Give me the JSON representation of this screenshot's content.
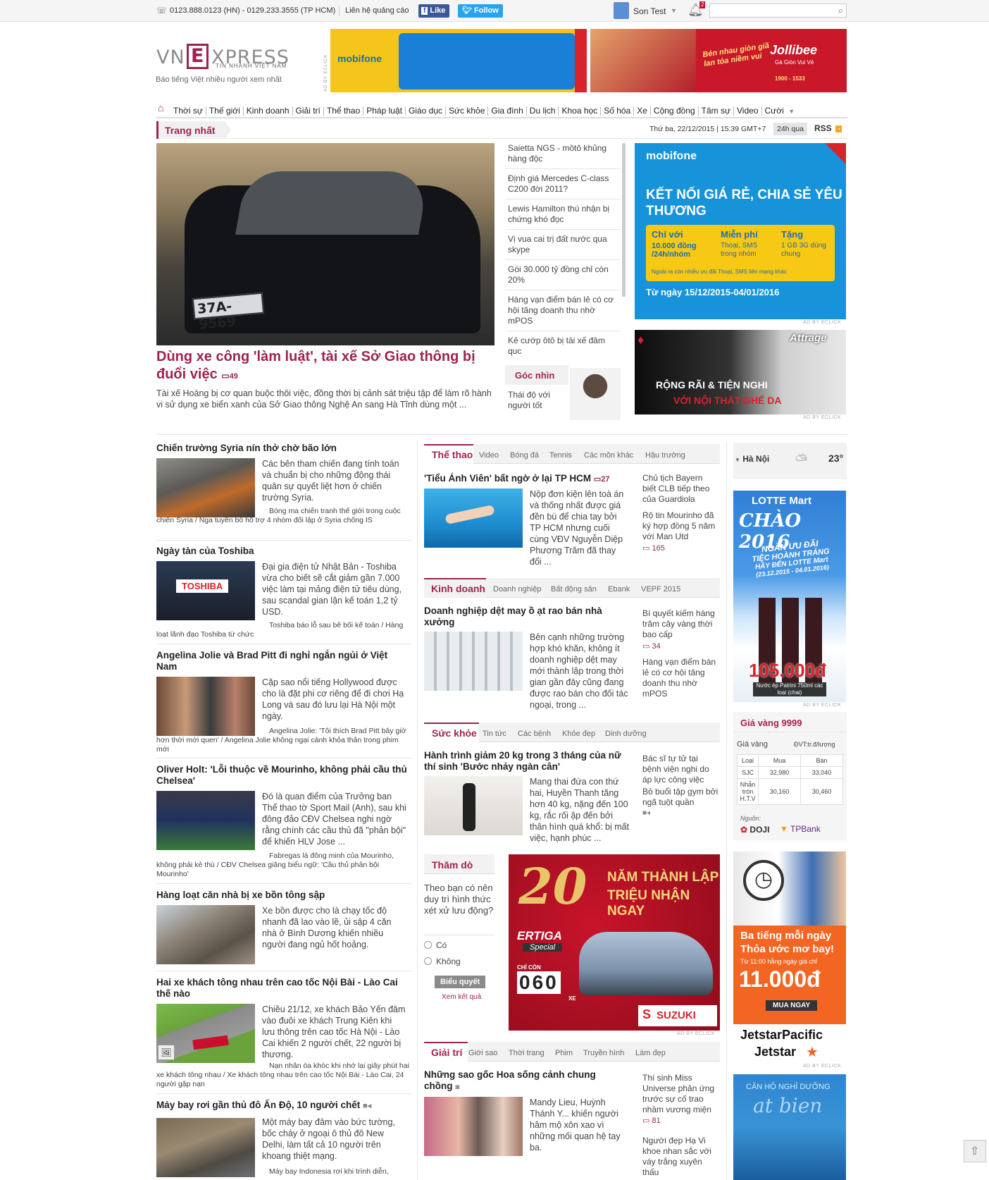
{
  "topbar": {
    "phone": "0123.888.0123 (HN) - 0129.233.3555 (TP HCM)",
    "ad_contact": "Liên hệ quảng cáo",
    "fb_like": "Like",
    "tw_follow": "Follow",
    "user_name": "Son Test",
    "notif_count": "2",
    "search_placeholder": ""
  },
  "logo": {
    "pre": "VN",
    "e": "E",
    "post": "XPRESS",
    "tagline_small": "TIN NHANH VIỆT NAM",
    "slogan": "Báo tiếng Việt nhiều người xem nhất"
  },
  "ads": {
    "ad_label": "AD BY ECLICK",
    "mobifone_top": "mobifone",
    "jollibee_slogan": "Bén nhau giòn giã lan tỏa niềm vui",
    "jollibee_brand": "Jollibee",
    "jollibee_sub": "Gà Giòn Vui Vẻ",
    "jollibee_phone": "1900 - 1533",
    "mobifone_big_brand": "mobifone",
    "mobifone_big_title": "KẾT NỐI GIÁ RẺ, CHIA SẺ YÊU THƯƠNG",
    "mobifone_col1_h": "Chỉ với",
    "mobifone_col1_t": "10.000 đồng /24h/nhóm",
    "mobifone_col2_h": "Miễn phí",
    "mobifone_col2_t": "Thoại, SMS trong nhóm",
    "mobifone_col3_h": "Tặng",
    "mobifone_col3_t": "1 GB 3G dùng chung",
    "mobifone_note": "Ngoài ra còn nhiều ưu đãi Thoại, SMS liên mạng khác",
    "mobifone_date": "Từ ngày 15/12/2015-04/01/2016",
    "mitsubishi_model": "Attrage",
    "mitsubishi_l1": "RỘNG RÃI & TIỆN NGHI",
    "mitsubishi_l2": "VỚI NỘI THẤT GHẾ DA",
    "lotte_brand": "LOTTE Mart",
    "lotte_chao": "CHÀO 2016",
    "lotte_l1": "NGÀN ƯU ĐÃI",
    "lotte_l2": "TIỆC HOÀNH TRÁNG",
    "lotte_l3": "HÃY ĐẾN LOTTE Mart",
    "lotte_date": "(23.12.2015 - 04.01.2016)",
    "lotte_price": "105.000đ",
    "lotte_item": "Nước ép Patrini 750ml các loại (chai)",
    "suzuki_20": "20",
    "suzuki_l1": "NĂM THÀNH LẬP",
    "suzuki_l2": "TRIỆU NHẬN NGAY",
    "suzuki_model": "ERTIGA",
    "suzuki_special": "Special",
    "suzuki_chicon": "CHỈ CÒN",
    "suzuki_num": "060",
    "suzuki_xe": "XE",
    "suzuki_brand": "SUZUKI",
    "jetstar_l1": "Ba tiếng mỗi ngày",
    "jetstar_l2": "Thỏa ước mơ bay!",
    "jetstar_l3": "Từ 11:00 hằng ngày giá chỉ",
    "jetstar_price": "11.000đ",
    "jetstar_buy": "MUA NGAY",
    "jetstar_brand1": "JetstarPacific",
    "jetstar_brand2": "Jetstar",
    "resort_l1": "CĂN HỘ NGHỈ DƯỠNG",
    "resort_l2": "at bien"
  },
  "nav": {
    "items": [
      "Thời sự",
      "Thế giới",
      "Kinh doanh",
      "Giải trí",
      "Thể thao",
      "Pháp luật",
      "Giáo dục",
      "Sức khỏe",
      "Gia đình",
      "Du lịch",
      "Khoa học",
      "Số hóa",
      "Xe",
      "Cộng đồng",
      "Tâm sự",
      "Video",
      "Cười"
    ]
  },
  "breadcrumb": {
    "label": "Trang nhất",
    "datetime": "Thứ ba, 22/12/2015 | 15:39 GMT+7",
    "btn_24h": "24h qua",
    "rss": "RSS"
  },
  "featured": {
    "plate": "37A-9569",
    "title": "Dùng xe công 'làm luật', tài xế Sở Giao thông bị đuổi việc",
    "comments": "49",
    "lead": "Tài xế Hoàng bị cơ quan buộc thôi việc, đồng thời bị cảnh sát triệu tập để làm rõ hành vi sử dụng xe biển xanh của Sở Giao thông Nghệ An sang Hà Tĩnh dùng một ..."
  },
  "side_news": [
    "Saietta NGS - môtô khủng hàng độc",
    "Định giá Mercedes C-class C200 đời 2011?",
    "Lewis Hamilton thú nhận bị chứng khó đọc",
    "Vị vua cai trị đất nước qua skype",
    "Gói 30.000 tỷ đồng chỉ còn 20%",
    "Hàng vạn điểm bán lẻ có cơ hội tăng doanh thu nhờ mPOS",
    "Kẻ cướp ôtô bị tài xế đâm quc"
  ],
  "gocnhin": {
    "label": "Góc nhìn",
    "text": "Thái độ với người tốt"
  },
  "left_news": [
    {
      "title": "Chiến trường Syria nín thở chờ bão lớn",
      "lead": "Các bên tham chiến đang tính toán và chuẩn bị cho những động thái quân sự quyết liệt hơn ở chiến trường Syria.",
      "sub": "Bóng ma chiến tranh thế giới trong cuộc chiến Syria / Nga tuyên bố hỗ trợ 4 nhóm đối lập ở Syria chống IS"
    },
    {
      "title": "Ngày tàn của Toshiba",
      "lead": "Đại gia điện tử Nhật Bản - Toshiba vừa cho biết sẽ cắt giảm gần 7.000 việc làm tại mảng điện tử tiêu dùng, sau scandal gian lận kế toán 1,2 tỷ USD.",
      "sub": "Toshiba báo lỗ sau bê bối kế toán / Hàng loạt lãnh đạo Toshiba từ chức",
      "sign": "TOSHIBA"
    },
    {
      "title": "Angelina Jolie và Brad Pitt đi nghỉ ngắn ngủi ở Việt Nam",
      "lead": "Cặp sao nổi tiếng Hollywood được cho là đặt phi cơ riêng để đi chơi Hạ Long và sau đó lưu lại Hà Nội một ngày.",
      "sub": "Angelina Jolie: 'Tôi thích Brad Pitt bây giờ hơn thời mới quen' / Angelina Jolie không ngại cảnh khỏa thân trong phim mới"
    },
    {
      "title": "Oliver Holt: 'Lỗi thuộc về Mourinho, không phải cầu thủ Chelsea'",
      "lead": "Đó là quan điểm của Trưởng ban Thể thao tờ Sport Mail (Anh), sau khi đông đảo CĐV Chelsea nghi ngờ rằng chính các cầu thủ đã \"phản bội\" để khiến HLV Jose ...",
      "sub": "Fabregas lá đông minh của Mourinho, không phải kẻ thù / CĐV Chelsea giăng biểu ngữ: 'Cầu thủ phản bội Mourinho'"
    },
    {
      "title": "Hàng loạt căn nhà bị xe bồn tông sập",
      "lead": "Xe bồn được cho là chạy tốc độ nhanh đã lao vào lề, ủi sập 4 căn nhà ở Bình Dương khiến nhiều người đang ngủ hốt hoảng.",
      "sub": ""
    },
    {
      "title": "Hai xe khách tông nhau trên cao tốc Nội Bài - Lào Cai thế nào",
      "lead": "Chiều 21/12, xe khách Bảo Yến đâm vào đuôi xe khách Trung Kiên khi lưu thông trên cao tốc Hà Nội - Lào Cai khiến 2 người chết, 22 người bị thương.",
      "sub": "Nạn nhân òa khóc khi nhớ lại giây phút hai xe khách tông nhau / Xe khách tông nhau trên cao tốc Nội Bài - Lào Cai, 24 người gặp nạn"
    },
    {
      "title": "Máy bay rơi gần thủ đô Ấn Độ, 10 người chết",
      "lead": "Một máy bay đâm vào bức tường, bốc cháy ở ngoại ô thủ đô New Delhi, làm tất cả 10 người trên khoang thiệt mạng.",
      "sub": "Máy bay Indonesia rơi khi trình diễn,"
    }
  ],
  "sections": [
    {
      "name": "Thể thao",
      "subs": [
        "Video",
        "Bóng đá",
        "Tennis",
        "Các môn khác",
        "Hậu trường"
      ],
      "main_title": "'Tiểu Ánh Viên' bất ngờ ở lại TP HCM",
      "main_cmt": "27",
      "main_lead": "Nộp đơn kiện lên toà án và thống nhất được giá đền bù để chia tay bởi TP HCM nhưng cuối cùng VĐV Nguyễn Diệp Phương Trâm đã thay đổi ...",
      "side": [
        "Chủ tịch Bayern biết CLB tiếp theo của Guardiola",
        "Rộ tin Mourinho đã ký hợp đồng 5 năm với Man Utd"
      ],
      "side_cmt": "165"
    },
    {
      "name": "Kinh doanh",
      "subs": [
        "Doanh nghiệp",
        "Bất động sản",
        "Ebank",
        "VEPF 2015"
      ],
      "main_title": "Doanh nghiệp dệt may ồ ạt rao bán nhà xưởng",
      "main_cmt": "",
      "main_lead": "Bên cạnh những trường hợp khó khăn, không ít doanh nghiệp dệt may mới thành lập trong thời gian gần đây cũng đang được rao bán cho đối tác ngoại, trong ...",
      "side": [
        "Bí quyết kiếm hàng trăm cây vàng thời bao cấp",
        "Hàng vạn điểm bán lẻ có cơ hội tăng doanh thu nhờ mPOS"
      ],
      "side_cmt": "34"
    },
    {
      "name": "Sức khỏe",
      "subs": [
        "Tin tức",
        "Các bệnh",
        "Khỏe đẹp",
        "Dinh dưỡng"
      ],
      "main_title": "Hành trình giảm 20 kg trong 3 tháng của nữ thí sinh 'Bước nhảy ngàn cân'",
      "main_cmt": "",
      "main_lead": "Mang thai đứa con thứ hai, Huyền Thanh tăng hơn 40 kg, nặng đến 100 kg, rắc rối ập đến bởi thân hình quá khổ: bị mất việc, hạnh phúc ...",
      "side": [
        "Bác sĩ tự tử tại bệnh viện nghi do áp lực công việc",
        "Bỏ buổi tập gym bởi ngã tuột quần"
      ],
      "side_cmt": ""
    },
    {
      "name": "Giải trí",
      "subs": [
        "Giới sao",
        "Thời trang",
        "Phim",
        "Truyền hình",
        "Làm đẹp"
      ],
      "main_title": "Những sao gốc Hoa sống cảnh chung chồng",
      "main_cmt": "",
      "main_lead": "Mandy Lieu, Huỳnh Thánh Y... khiến người hâm mộ xôn xao vì những mối quan hệ tay ba.",
      "side": [
        "Thí sinh Miss Universe phản ứng trước sự cố trao nhầm vương miện",
        "Người đẹp Hạ Vi khoe nhan sắc với váy trắng xuyên thấu"
      ],
      "side_cmt": "81"
    }
  ],
  "poll": {
    "title": "Thăm dò",
    "question": "Theo bạn có nên duy trì hình thức xét xử lưu động?",
    "opt1": "Có",
    "opt2": "Không",
    "vote": "Biểu quyết",
    "results": "Xem kết quả"
  },
  "weather": {
    "city": "Hà Nội",
    "temp": "23°"
  },
  "gold": {
    "title": "Giá vàng 9999",
    "sub_left": "Giá vàng",
    "unit": "ĐVT:tr.đ/lượng",
    "headers": [
      "Loại",
      "Mua",
      "Bán"
    ],
    "rows": [
      [
        "SJC",
        "32,980",
        "33,040"
      ],
      [
        "Nhẫn tròn H.T.V",
        "30,160",
        "30,460"
      ]
    ],
    "source": "Nguồn:",
    "src1": "DOJI",
    "src2": "TPBank"
  }
}
